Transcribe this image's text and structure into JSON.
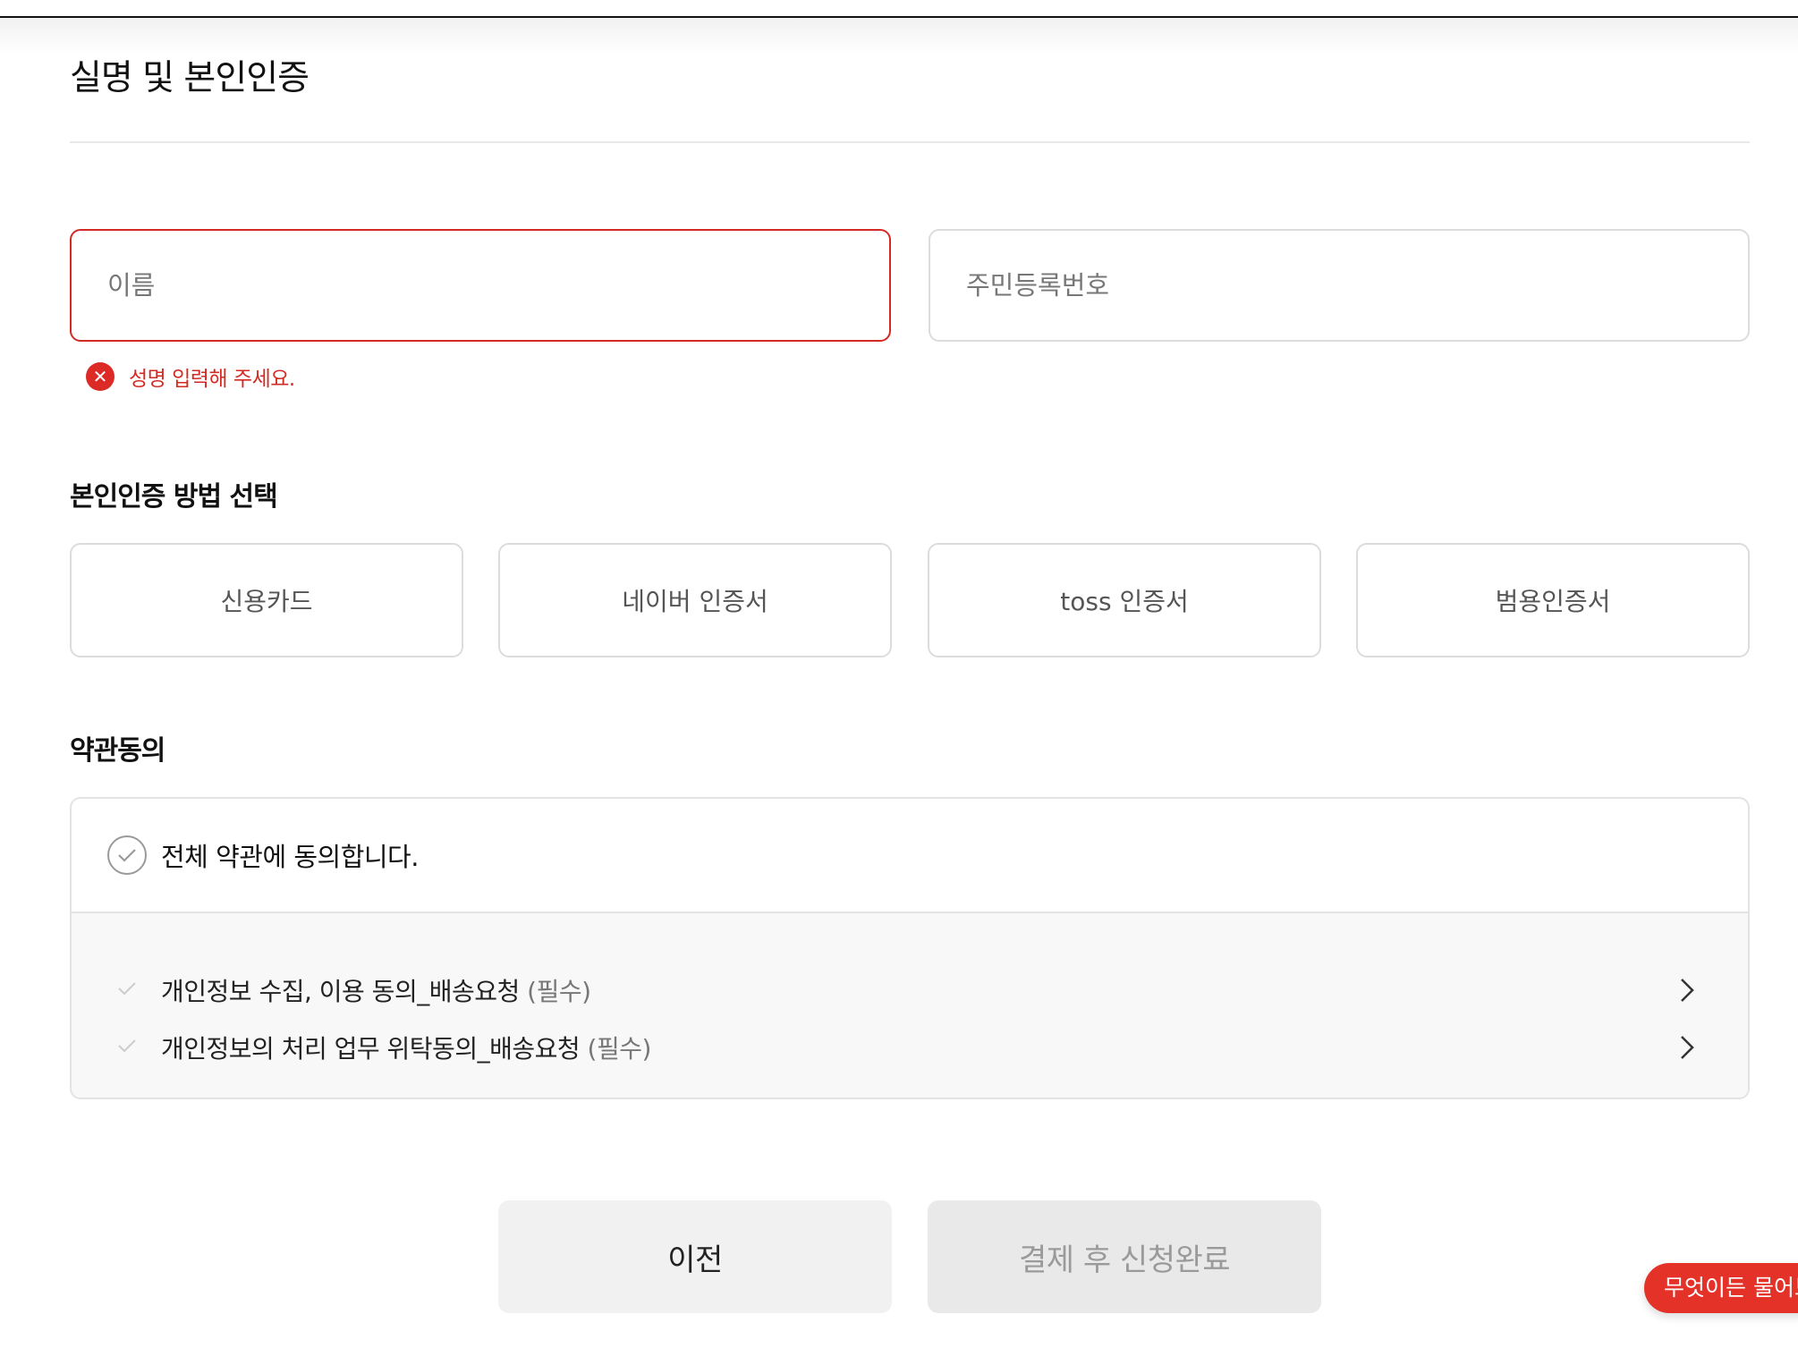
{
  "page": {
    "title": "실명 및 본인인증"
  },
  "form": {
    "name_placeholder": "이름",
    "rrn_placeholder": "주민등록번호",
    "name_error": "성명 입력해 주세요."
  },
  "verification": {
    "title": "본인인증 방법 선택",
    "methods": [
      "신용카드",
      "네이버 인증서",
      "toss 인증서",
      "범용인증서"
    ]
  },
  "terms": {
    "title": "약관동의",
    "all_label": "전체 약관에 동의합니다.",
    "items": [
      {
        "label": "개인정보 수집, 이용 동의_배송요청",
        "required": "(필수)"
      },
      {
        "label": "개인정보의 처리 업무 위탁동의_배송요청",
        "required": "(필수)"
      }
    ]
  },
  "actions": {
    "prev_label": "이전",
    "submit_label": "결제 후 신청완료"
  },
  "chat": {
    "label": "무엇이든 물어보세요"
  },
  "colors": {
    "error": "#d32b23",
    "chat": "#e43229"
  }
}
